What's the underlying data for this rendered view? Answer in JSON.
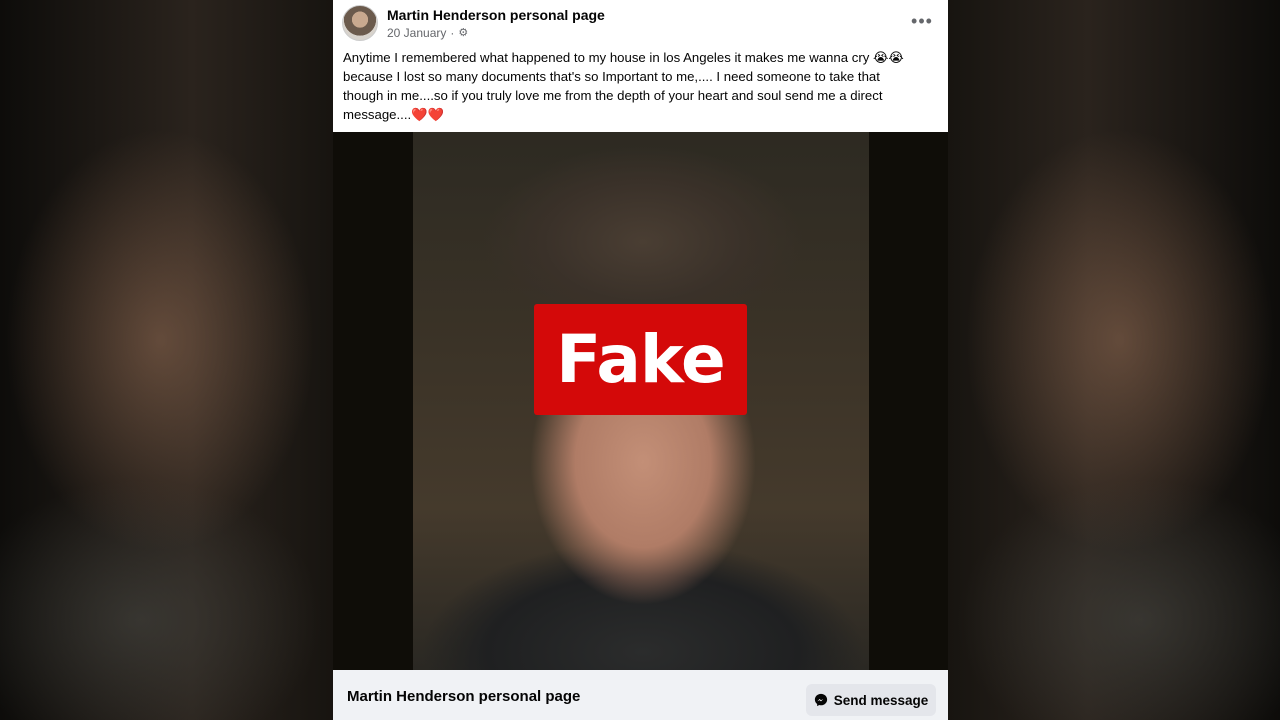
{
  "post": {
    "author": "Martin Henderson personal page",
    "date": "20 January",
    "privacy_icon": "gear-icon",
    "more_icon": "more-dots-icon",
    "more_label": "•••",
    "text": "Anytime I remembered what happened to my house in los Angeles it makes me wanna cry 😭😭\nbecause I lost so many documents that's so Important to me,.... I need someone to take that\nthough in me....so if you truly love me from the depth of your heart and soul send me a direct\nmessage....❤️❤️"
  },
  "photo": {
    "overlay_label": "Fake",
    "overlay_color": "#d40909"
  },
  "footer": {
    "page_name": "Martin Henderson personal page",
    "send_label": "Send message",
    "send_icon": "messenger-icon"
  }
}
